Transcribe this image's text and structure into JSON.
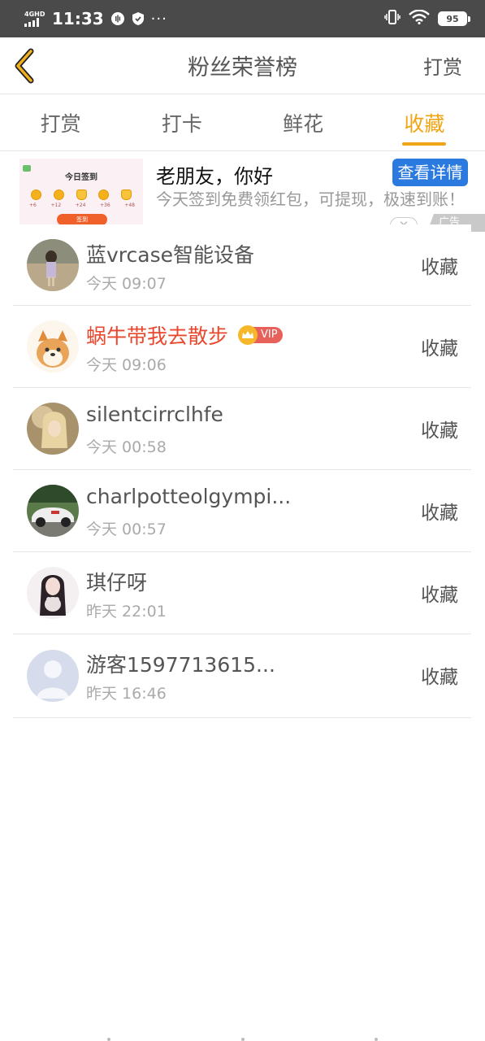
{
  "status_bar": {
    "network": "4GHD",
    "time": "11:33",
    "battery": "95"
  },
  "header": {
    "title": "粉丝荣誉榜",
    "right_action": "打赏"
  },
  "tabs": [
    {
      "label": "打赏",
      "active": false
    },
    {
      "label": "打卡",
      "active": false
    },
    {
      "label": "鲜花",
      "active": false
    },
    {
      "label": "收藏",
      "active": true
    }
  ],
  "ad": {
    "thumb_title": "今日签到",
    "thumb_values": [
      "+6",
      "+12",
      "+24",
      "+36",
      "+48"
    ],
    "thumb_button": "签到",
    "title": "老朋友，你好",
    "button": "查看详情",
    "description": "今天签到免费领红包，可提现，极速到账！",
    "close": "✕",
    "tag": "广告"
  },
  "list": [
    {
      "name": "蓝vrcase智能设备",
      "time": "今天 09:07",
      "action": "收藏",
      "vip": false
    },
    {
      "name": "蜗牛带我去散步",
      "time": "今天 09:06",
      "action": "收藏",
      "vip": true,
      "vip_label": "VIP"
    },
    {
      "name": "silentcirrclhfe",
      "time": "今天 00:58",
      "action": "收藏",
      "vip": false
    },
    {
      "name": "charlpotteolgympi...",
      "time": "今天 00:57",
      "action": "收藏",
      "vip": false
    },
    {
      "name": "琪仔呀",
      "time": "昨天 22:01",
      "action": "收藏",
      "vip": false
    },
    {
      "name": "游客1597713615...",
      "time": "昨天 16:46",
      "action": "收藏",
      "vip": false
    }
  ],
  "colors": {
    "accent": "#f0a516",
    "vip_name": "#e8492e",
    "ad_button": "#2a7ae0"
  }
}
